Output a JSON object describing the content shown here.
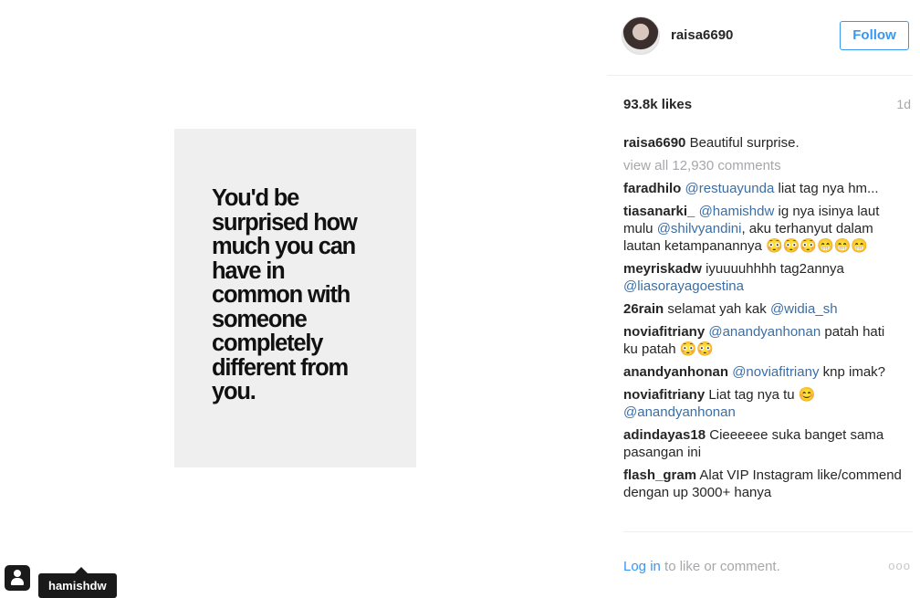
{
  "post": {
    "image_text": "You'd be\nsurprised how\nmuch you can\nhave in\ncommon with\nsomeone\ncompletely\ndifferent from\nyou."
  },
  "header": {
    "username": "raisa6690",
    "follow_label": "Follow",
    "avatar_icon": "profile-avatar"
  },
  "stats": {
    "likes": "93.8k likes",
    "time": "1d"
  },
  "caption": {
    "user": "raisa6690",
    "text": "Beautiful surprise."
  },
  "view_all": "view all 12,930 comments",
  "comments": [
    {
      "user": "faradhilo",
      "parts": [
        {
          "m": "@restuayunda"
        },
        {
          "t": " liat tag nya hm..."
        }
      ]
    },
    {
      "user": "tiasanarki_",
      "parts": [
        {
          "m": "@hamishdw"
        },
        {
          "t": " ig nya isinya laut mulu "
        },
        {
          "m": "@shilvyandini"
        },
        {
          "t": ", aku terhanyut dalam lautan ketampanannya 😳😳😳😁😁😁"
        }
      ]
    },
    {
      "user": "meyriskadw",
      "parts": [
        {
          "t": "iyuuuuhhhh tag2annya "
        },
        {
          "m": "@liasorayagoestina"
        }
      ]
    },
    {
      "user": "26rain",
      "parts": [
        {
          "t": "selamat yah kak "
        },
        {
          "m": "@widia_sh"
        }
      ]
    },
    {
      "user": "noviafitriany",
      "parts": [
        {
          "m": "@anandyanhonan"
        },
        {
          "t": " patah hati ku patah 😳😳"
        }
      ]
    },
    {
      "user": "anandyanhonan",
      "parts": [
        {
          "m": "@noviafitriany"
        },
        {
          "t": " knp imak?"
        }
      ]
    },
    {
      "user": "noviafitriany",
      "parts": [
        {
          "t": "Liat tag nya tu 😊 "
        },
        {
          "m": "@anandyanhonan"
        }
      ]
    },
    {
      "user": "adindayas18",
      "parts": [
        {
          "t": "Cieeeeee suka banget sama pasangan ini"
        }
      ]
    },
    {
      "user": "flash_gram",
      "parts": [
        {
          "t": "Alat VIP Instagram like/commend dengan up 3000+ hanya"
        }
      ]
    }
  ],
  "footer": {
    "login_link": "Log in",
    "login_rest": " to like or comment.",
    "more_label": "ooo"
  },
  "tag": {
    "label": "hamishdw",
    "icon": "user-tag-icon"
  }
}
